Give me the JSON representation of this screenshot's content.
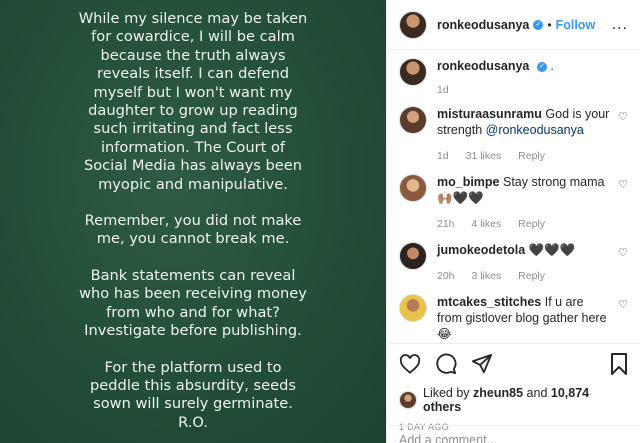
{
  "post_text": [
    "While my silence may be taken\nfor cowardice, I will be calm\nbecause the truth always\nreveals itself. I can defend\nmyself but I won't want my\ndaughter to grow up reading\nsuch irritating and fact less\ninformation. The Court of\nSocial Media has always been\nmyopic and manipulative.",
    "Remember, you did not make\nme, you cannot break me.",
    "Bank statements can reveal\nwho has been receiving money\nfrom who and for what?\nInvestigate before publishing.",
    "For the platform used to\npeddle this absurdity, seeds\nsown will surely germinate.\nR.O."
  ],
  "header": {
    "username": "ronkeodusanya",
    "separator": "•",
    "follow_label": "Follow",
    "more": "..."
  },
  "caption": {
    "username": "ronkeodusanya",
    "text": ".",
    "time": "1d"
  },
  "comments": [
    {
      "username": "misturaasunramu",
      "text": "God is your strength",
      "mention": "@ronkeodusanya",
      "time": "1d",
      "likes": "31 likes",
      "reply": "Reply"
    },
    {
      "username": "mo_bimpe",
      "text": "Stay strong mama 🙌🏽🖤🖤",
      "mention": "",
      "time": "21h",
      "likes": "4 likes",
      "reply": "Reply"
    },
    {
      "username": "jumokeodetola",
      "text": "🖤🖤🖤",
      "mention": "",
      "time": "20h",
      "likes": "3 likes",
      "reply": "Reply"
    },
    {
      "username": "mtcakes_stitches",
      "text": "If u are from gistlover blog gather here 😂",
      "mention": "",
      "time": "",
      "likes": "",
      "reply": ""
    }
  ],
  "likes": {
    "prefix": "Liked by",
    "user": "zheun85",
    "and": "and",
    "others": "10,874 others"
  },
  "date": "1 DAY AGO",
  "add_comment_placeholder": "Add a comment...",
  "icons": [
    "heart-icon",
    "comment-icon",
    "share-icon",
    "bookmark-icon"
  ],
  "colors": {
    "accent": "#3897f0",
    "post_bg": "#25503a",
    "muted": "#8e8e8e"
  }
}
